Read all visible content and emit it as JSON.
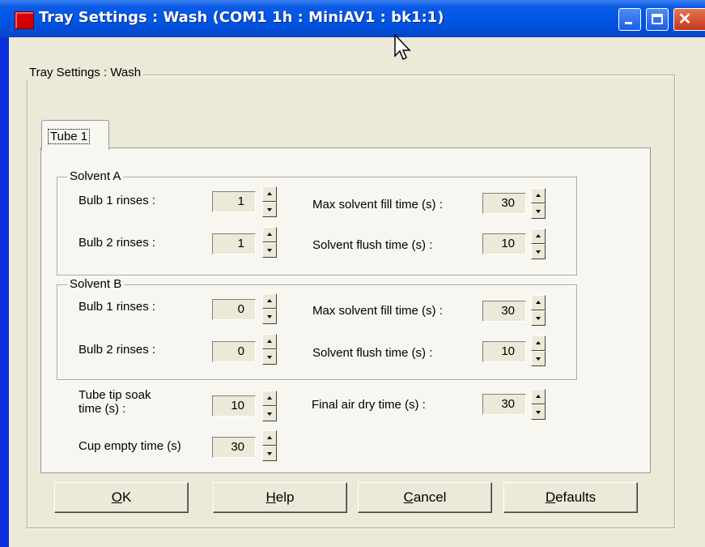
{
  "window": {
    "title": "Tray Settings : Wash  (COM1 1h : MiniAV1 : bk1:1)",
    "group_title": "Tray Settings : Wash",
    "controls": {
      "minimize_icon": "minimize-icon",
      "maximize_icon": "maximize-icon",
      "close_icon": "close-icon",
      "close_glyph": "✕"
    }
  },
  "tabs": [
    {
      "label": "Tube 1",
      "selected": true
    }
  ],
  "solvent_a": {
    "title": "Solvent A",
    "bulb1_label": "Bulb 1 rinses :",
    "bulb1_value": "1",
    "bulb2_label": "Bulb 2 rinses :",
    "bulb2_value": "1",
    "fill_label": "Max solvent fill time (s) :",
    "fill_value": "30",
    "flush_label": "Solvent flush time (s) :",
    "flush_value": "10"
  },
  "solvent_b": {
    "title": "Solvent B",
    "bulb1_label": "Bulb 1 rinses :",
    "bulb1_value": "0",
    "bulb2_label": "Bulb 2 rinses :",
    "bulb2_value": "0",
    "fill_label": "Max solvent fill time (s) :",
    "fill_value": "30",
    "flush_label": "Solvent flush time (s) :",
    "flush_value": "10"
  },
  "other": {
    "soak_label_line1": "Tube tip soak",
    "soak_label_line2": "time (s) :",
    "soak_value": "10",
    "cup_label": "Cup empty time (s)",
    "cup_value": "30",
    "air_label": "Final air dry time (s) :",
    "air_value": "30"
  },
  "buttons": {
    "ok": {
      "mnemonic": "O",
      "rest": "K"
    },
    "help": {
      "mnemonic": "H",
      "rest": "elp"
    },
    "cancel": {
      "mnemonic": "C",
      "rest": "ancel"
    },
    "defaults": {
      "mnemonic": "D",
      "rest": "efaults"
    }
  },
  "colors": {
    "titlebar": "#0054e3",
    "face": "#ece9d8",
    "close_button": "#c3381c",
    "app_icon": "#d40000"
  }
}
